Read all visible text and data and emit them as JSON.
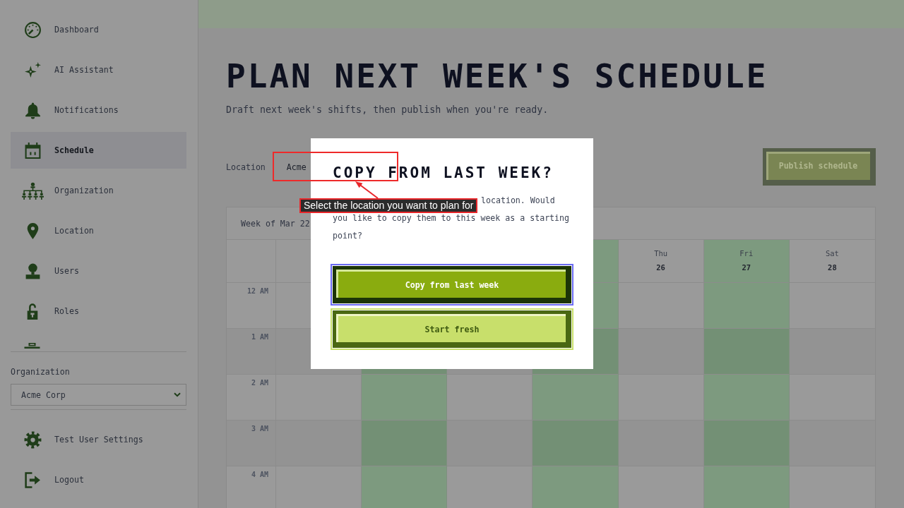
{
  "sidebar": {
    "items": [
      {
        "label": "Dashboard",
        "selected": false
      },
      {
        "label": "AI Assistant",
        "selected": false
      },
      {
        "label": "Notifications",
        "selected": false
      },
      {
        "label": "Schedule",
        "selected": true
      },
      {
        "label": "Organization",
        "selected": false
      },
      {
        "label": "Location",
        "selected": false
      },
      {
        "label": "Users",
        "selected": false
      },
      {
        "label": "Roles",
        "selected": false
      }
    ],
    "organization": {
      "label": "Organization",
      "value": "Acme Corp"
    },
    "footer_items": [
      {
        "label": "Test User Settings"
      },
      {
        "label": "Logout"
      }
    ]
  },
  "page": {
    "title": "PLAN NEXT WEEK'S SCHEDULE",
    "subtitle": "Draft next week's shifts, then publish when you're ready.",
    "location": {
      "label": "Location",
      "value": "Acme"
    },
    "publish_button": {
      "label": "Publish schedule",
      "disabled": true
    }
  },
  "calendar": {
    "week_label": "Week of Mar 22",
    "days": [
      {
        "shaded": false
      },
      {
        "shaded": true
      },
      {
        "shaded": false
      },
      {
        "shaded": true
      },
      {
        "weekday": "Thu",
        "date": "26",
        "shaded": false
      },
      {
        "weekday": "Fri",
        "date": "27",
        "shaded": true
      },
      {
        "weekday": "Sat",
        "date": "28",
        "shaded": false
      }
    ],
    "hours": [
      "12 AM",
      "1 AM",
      "2 AM",
      "3 AM",
      "4 AM"
    ]
  },
  "dialog": {
    "title": "COPY FROM LAST WEEK?",
    "body": [
      "location. Would",
      "you like to copy them to this week as a starting point?"
    ],
    "buttons": [
      {
        "label": "Copy from last week",
        "kind": "primary",
        "focused": true
      },
      {
        "label": "Start fresh",
        "kind": "secondary",
        "focused": false
      }
    ]
  },
  "annotation": {
    "tooltip": "Select the location you want to plan for"
  }
}
